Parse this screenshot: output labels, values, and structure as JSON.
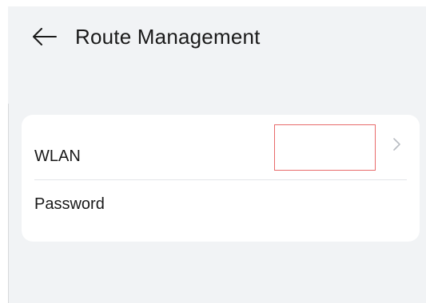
{
  "header": {
    "back_icon": "arrow-left-icon",
    "title": "Route Management"
  },
  "settings": {
    "items": [
      {
        "label": "WLAN",
        "value": "",
        "icon": "chevron-right-icon"
      },
      {
        "label": "Password"
      }
    ]
  },
  "colors": {
    "background": "#f1f3f5",
    "card": "#ffffff",
    "text": "#1a1a1a",
    "highlight_border": "#e86a6a",
    "chevron": "#b8bcc2"
  }
}
